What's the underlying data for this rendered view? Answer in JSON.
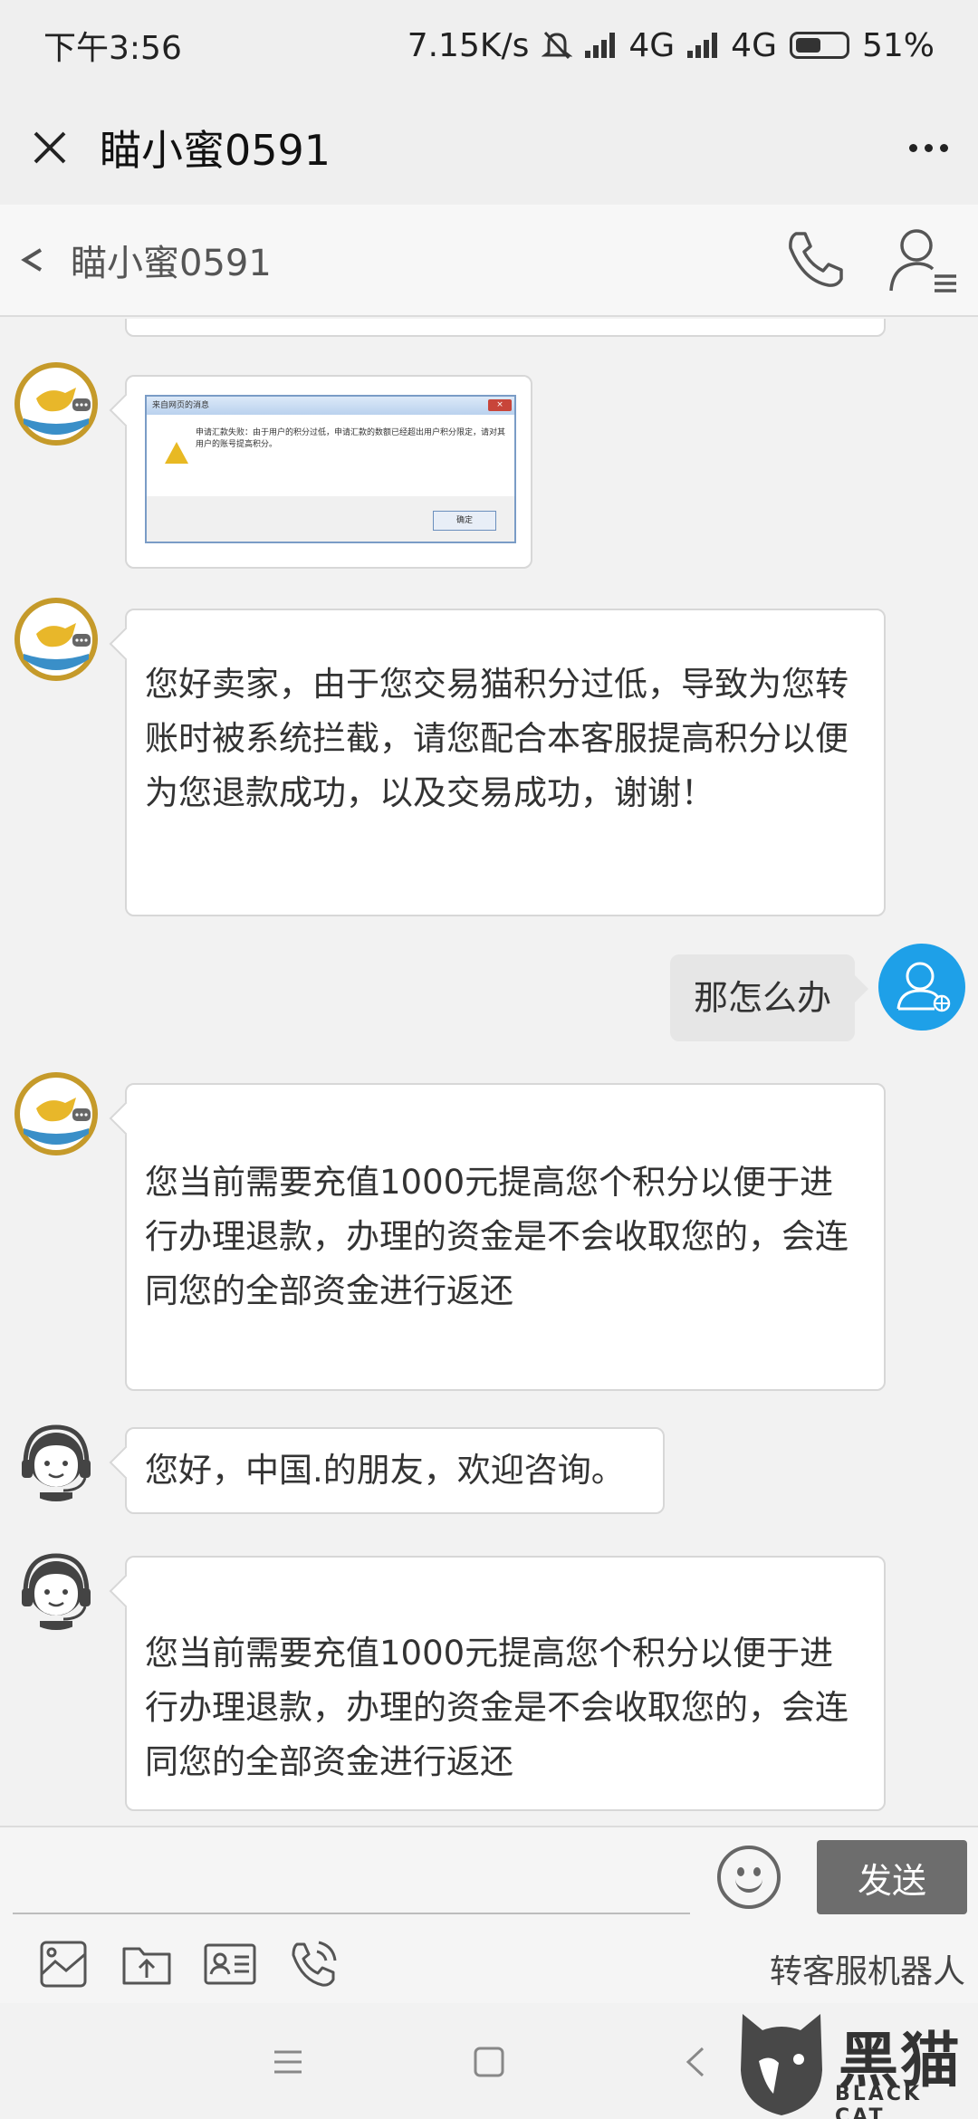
{
  "status_bar": {
    "time": "下午3:56",
    "net_speed": "7.15K/s",
    "network1": "4G",
    "network2": "4G",
    "battery": "51%"
  },
  "web_header": {
    "title": "瞄小蜜0591"
  },
  "chat_header": {
    "title": "瞄小蜜0591"
  },
  "messages": [
    {
      "side": "in",
      "kind": "image",
      "dialog": {
        "title": "来自网页的消息",
        "body": "申请汇款失败：由于用户的积分过低，申请汇款的数额已经超出用户积分限定，请对其用户的账号提高积分。",
        "ok": "确定"
      }
    },
    {
      "side": "in",
      "text": "您好卖家，由于您交易猫积分过低，导致为您转账时被系统拦截，请您配合本客服提高积分以便为您退款成功，以及交易成功，谢谢！"
    },
    {
      "side": "out",
      "text": "那怎么办"
    },
    {
      "side": "in",
      "text": "您当前需要充值1000元提高您个积分以便于进行办理退款，办理的资金是不会收取您的，会连同您的全部资金进行返还"
    },
    {
      "side": "in",
      "text": "您好，中国.的朋友，欢迎咨询。"
    },
    {
      "side": "in",
      "text": "您当前需要充值1000元提高您个积分以便于进行办理退款，办理的资金是不会收取您的，会连同您的全部资金进行返还"
    }
  ],
  "input_bar": {
    "send_label": "发送"
  },
  "toolbar": {
    "robot_label": "转客服机器人"
  },
  "watermark": {
    "text": "黑猫",
    "sub": "BLACK CAT"
  }
}
